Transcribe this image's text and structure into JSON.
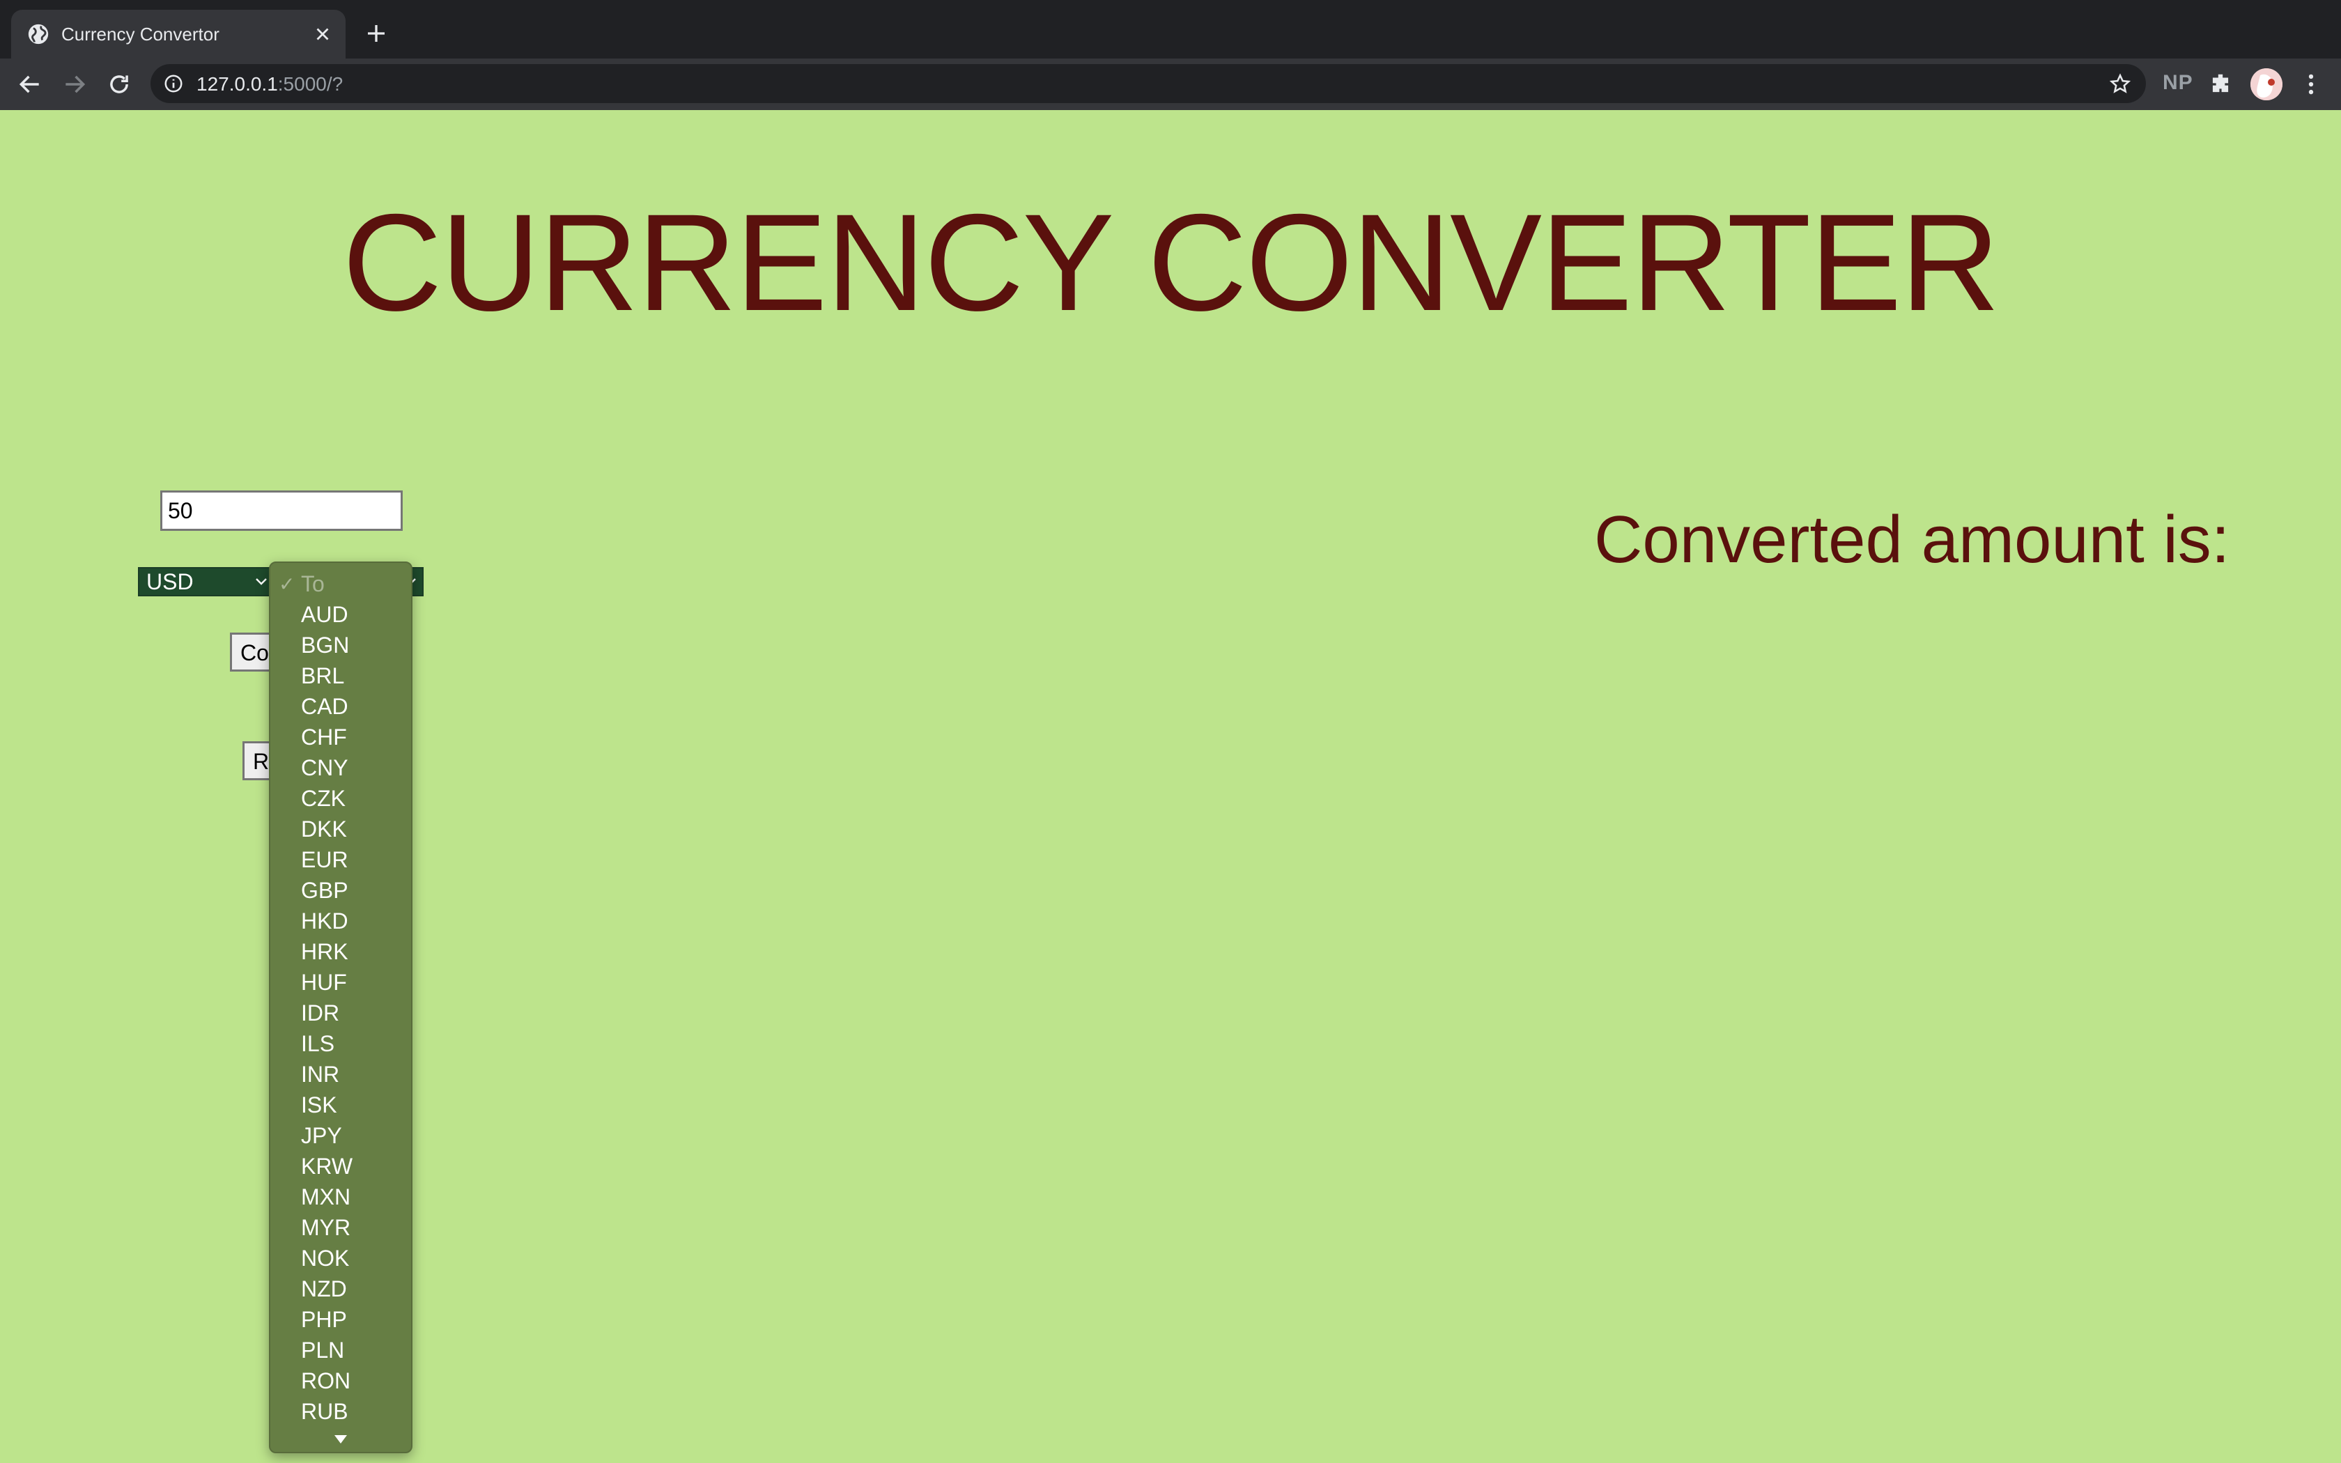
{
  "browser": {
    "tab_title": "Currency Convertor",
    "url_host": "127.0.0.1",
    "url_rest": ":5000/?",
    "extension_label": "NP"
  },
  "page": {
    "heading": "CURRENCY CONVERTER",
    "amount_value": "50",
    "from_currency": "USD",
    "convert_button": "Co",
    "reset_button": "Re",
    "result_label": "Converted amount is:"
  },
  "dropdown": {
    "placeholder": "To",
    "options": [
      "AUD",
      "BGN",
      "BRL",
      "CAD",
      "CHF",
      "CNY",
      "CZK",
      "DKK",
      "EUR",
      "GBP",
      "HKD",
      "HRK",
      "HUF",
      "IDR",
      "ILS",
      "INR",
      "ISK",
      "JPY",
      "KRW",
      "MXN",
      "MYR",
      "NOK",
      "NZD",
      "PHP",
      "PLN",
      "RON",
      "RUB"
    ]
  },
  "colors": {
    "page_background": "#bde48c",
    "heading_text": "#5a110d",
    "select_background": "#1e4a2c",
    "dropdown_background": "#667e44"
  }
}
